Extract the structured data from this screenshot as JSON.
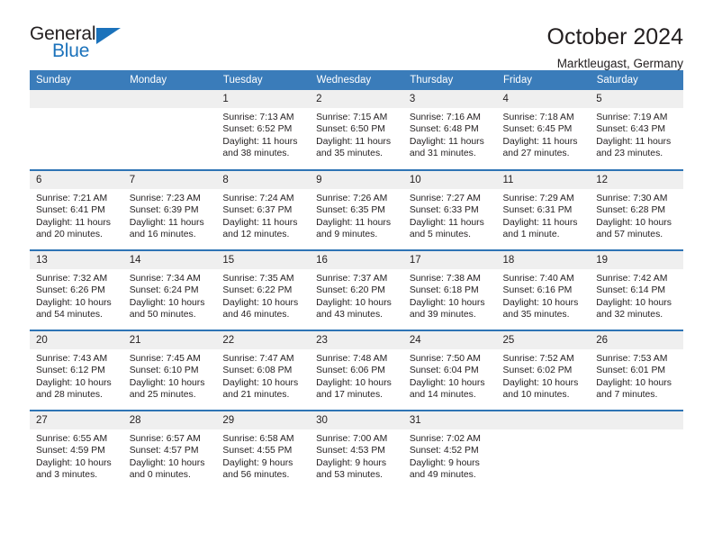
{
  "brand": {
    "name_part1": "General",
    "name_part2": "Blue",
    "accent_color": "#1b72bb"
  },
  "header": {
    "title": "October 2024",
    "subtitle": "Marktleugast, Germany",
    "header_bg": "#3a7cba",
    "daynum_bg": "#efefef",
    "row_rule_color": "#2e74b5"
  },
  "weekdays": [
    "Sunday",
    "Monday",
    "Tuesday",
    "Wednesday",
    "Thursday",
    "Friday",
    "Saturday"
  ],
  "weeks": [
    [
      {
        "day": "",
        "blank": true
      },
      {
        "day": "",
        "blank": true
      },
      {
        "day": "1",
        "sunrise": "Sunrise: 7:13 AM",
        "sunset": "Sunset: 6:52 PM",
        "daylight": "Daylight: 11 hours and 38 minutes."
      },
      {
        "day": "2",
        "sunrise": "Sunrise: 7:15 AM",
        "sunset": "Sunset: 6:50 PM",
        "daylight": "Daylight: 11 hours and 35 minutes."
      },
      {
        "day": "3",
        "sunrise": "Sunrise: 7:16 AM",
        "sunset": "Sunset: 6:48 PM",
        "daylight": "Daylight: 11 hours and 31 minutes."
      },
      {
        "day": "4",
        "sunrise": "Sunrise: 7:18 AM",
        "sunset": "Sunset: 6:45 PM",
        "daylight": "Daylight: 11 hours and 27 minutes."
      },
      {
        "day": "5",
        "sunrise": "Sunrise: 7:19 AM",
        "sunset": "Sunset: 6:43 PM",
        "daylight": "Daylight: 11 hours and 23 minutes."
      }
    ],
    [
      {
        "day": "6",
        "sunrise": "Sunrise: 7:21 AM",
        "sunset": "Sunset: 6:41 PM",
        "daylight": "Daylight: 11 hours and 20 minutes."
      },
      {
        "day": "7",
        "sunrise": "Sunrise: 7:23 AM",
        "sunset": "Sunset: 6:39 PM",
        "daylight": "Daylight: 11 hours and 16 minutes."
      },
      {
        "day": "8",
        "sunrise": "Sunrise: 7:24 AM",
        "sunset": "Sunset: 6:37 PM",
        "daylight": "Daylight: 11 hours and 12 minutes."
      },
      {
        "day": "9",
        "sunrise": "Sunrise: 7:26 AM",
        "sunset": "Sunset: 6:35 PM",
        "daylight": "Daylight: 11 hours and 9 minutes."
      },
      {
        "day": "10",
        "sunrise": "Sunrise: 7:27 AM",
        "sunset": "Sunset: 6:33 PM",
        "daylight": "Daylight: 11 hours and 5 minutes."
      },
      {
        "day": "11",
        "sunrise": "Sunrise: 7:29 AM",
        "sunset": "Sunset: 6:31 PM",
        "daylight": "Daylight: 11 hours and 1 minute."
      },
      {
        "day": "12",
        "sunrise": "Sunrise: 7:30 AM",
        "sunset": "Sunset: 6:28 PM",
        "daylight": "Daylight: 10 hours and 57 minutes."
      }
    ],
    [
      {
        "day": "13",
        "sunrise": "Sunrise: 7:32 AM",
        "sunset": "Sunset: 6:26 PM",
        "daylight": "Daylight: 10 hours and 54 minutes."
      },
      {
        "day": "14",
        "sunrise": "Sunrise: 7:34 AM",
        "sunset": "Sunset: 6:24 PM",
        "daylight": "Daylight: 10 hours and 50 minutes."
      },
      {
        "day": "15",
        "sunrise": "Sunrise: 7:35 AM",
        "sunset": "Sunset: 6:22 PM",
        "daylight": "Daylight: 10 hours and 46 minutes."
      },
      {
        "day": "16",
        "sunrise": "Sunrise: 7:37 AM",
        "sunset": "Sunset: 6:20 PM",
        "daylight": "Daylight: 10 hours and 43 minutes."
      },
      {
        "day": "17",
        "sunrise": "Sunrise: 7:38 AM",
        "sunset": "Sunset: 6:18 PM",
        "daylight": "Daylight: 10 hours and 39 minutes."
      },
      {
        "day": "18",
        "sunrise": "Sunrise: 7:40 AM",
        "sunset": "Sunset: 6:16 PM",
        "daylight": "Daylight: 10 hours and 35 minutes."
      },
      {
        "day": "19",
        "sunrise": "Sunrise: 7:42 AM",
        "sunset": "Sunset: 6:14 PM",
        "daylight": "Daylight: 10 hours and 32 minutes."
      }
    ],
    [
      {
        "day": "20",
        "sunrise": "Sunrise: 7:43 AM",
        "sunset": "Sunset: 6:12 PM",
        "daylight": "Daylight: 10 hours and 28 minutes."
      },
      {
        "day": "21",
        "sunrise": "Sunrise: 7:45 AM",
        "sunset": "Sunset: 6:10 PM",
        "daylight": "Daylight: 10 hours and 25 minutes."
      },
      {
        "day": "22",
        "sunrise": "Sunrise: 7:47 AM",
        "sunset": "Sunset: 6:08 PM",
        "daylight": "Daylight: 10 hours and 21 minutes."
      },
      {
        "day": "23",
        "sunrise": "Sunrise: 7:48 AM",
        "sunset": "Sunset: 6:06 PM",
        "daylight": "Daylight: 10 hours and 17 minutes."
      },
      {
        "day": "24",
        "sunrise": "Sunrise: 7:50 AM",
        "sunset": "Sunset: 6:04 PM",
        "daylight": "Daylight: 10 hours and 14 minutes."
      },
      {
        "day": "25",
        "sunrise": "Sunrise: 7:52 AM",
        "sunset": "Sunset: 6:02 PM",
        "daylight": "Daylight: 10 hours and 10 minutes."
      },
      {
        "day": "26",
        "sunrise": "Sunrise: 7:53 AM",
        "sunset": "Sunset: 6:01 PM",
        "daylight": "Daylight: 10 hours and 7 minutes."
      }
    ],
    [
      {
        "day": "27",
        "sunrise": "Sunrise: 6:55 AM",
        "sunset": "Sunset: 4:59 PM",
        "daylight": "Daylight: 10 hours and 3 minutes."
      },
      {
        "day": "28",
        "sunrise": "Sunrise: 6:57 AM",
        "sunset": "Sunset: 4:57 PM",
        "daylight": "Daylight: 10 hours and 0 minutes."
      },
      {
        "day": "29",
        "sunrise": "Sunrise: 6:58 AM",
        "sunset": "Sunset: 4:55 PM",
        "daylight": "Daylight: 9 hours and 56 minutes."
      },
      {
        "day": "30",
        "sunrise": "Sunrise: 7:00 AM",
        "sunset": "Sunset: 4:53 PM",
        "daylight": "Daylight: 9 hours and 53 minutes."
      },
      {
        "day": "31",
        "sunrise": "Sunrise: 7:02 AM",
        "sunset": "Sunset: 4:52 PM",
        "daylight": "Daylight: 9 hours and 49 minutes."
      },
      {
        "day": "",
        "blank": true
      },
      {
        "day": "",
        "blank": true
      }
    ]
  ]
}
